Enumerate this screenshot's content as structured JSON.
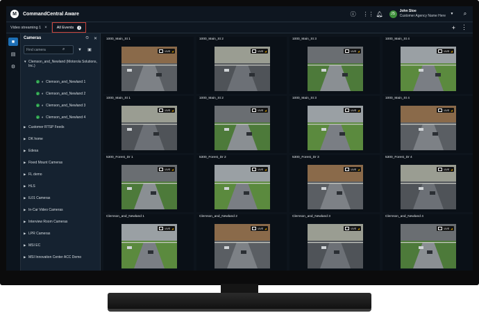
{
  "app": {
    "title": "CommandCentral Aware",
    "logo_glyph": "M",
    "user": {
      "name": "John Stoe",
      "org": "Customer Agency Name Here",
      "initials": "JS"
    },
    "top_icons": [
      "info-icon",
      "apps-grid-icon",
      "bell-icon",
      "search-icon"
    ]
  },
  "tabs": [
    {
      "label": "Video streaming 1",
      "close": "×"
    },
    {
      "label": "All Events",
      "info": "i"
    }
  ],
  "tab_actions": {
    "add": "+",
    "more": "⋮"
  },
  "rail": [
    "video-camera-icon",
    "cards-icon",
    "settings-icon"
  ],
  "cameras_panel": {
    "title": "Cameras",
    "search_placeholder": "Find camera",
    "tree": {
      "root": "Clemson_and_Newland (Motorola Solutions, Inc.)",
      "cameras": [
        "Clemson_and_Newland 1",
        "Clemson_and_Newland 2",
        "Clemson_and_Newland 3",
        "Clemson_and_Newland 4"
      ],
      "groups": [
        "Customer RTSP Feeds",
        "DK home",
        "Edesa",
        "Fixed Mount Cameras",
        "FL demo",
        "HLS",
        "IL01 Cameras",
        "In-Car Video Cameras",
        "Interview Room Cameras",
        "LPR Cameras",
        "MSI EC",
        "MSI Innovation Center ACC Demo"
      ]
    }
  },
  "grid": {
    "live_label": "LIVE",
    "rows": [
      [
        "1000_Main_St 1",
        "1000_Main_St 2",
        "1000_Main_St 3",
        "1000_Main_St 4"
      ],
      [
        "1000_Main_St 1",
        "1000_Main_St 2",
        "1000_Main_St 3",
        "1000_Main_St 4"
      ],
      [
        "5300_Forest_Dr 1",
        "5300_Forest_Dr 2",
        "5300_Forest_Dr 3",
        "5300_Forest_Dr 4"
      ],
      [
        "Clemson_and_Newland 1",
        "Clemson_and_Newland 2",
        "Clemson_and_Newland 3",
        "Clemson_and_Newland 4"
      ]
    ]
  },
  "colors": {
    "accent": "#1d6fb5",
    "active_tab_border": "#c8443c",
    "online": "#2aa34a",
    "signal": "#e0a400"
  }
}
